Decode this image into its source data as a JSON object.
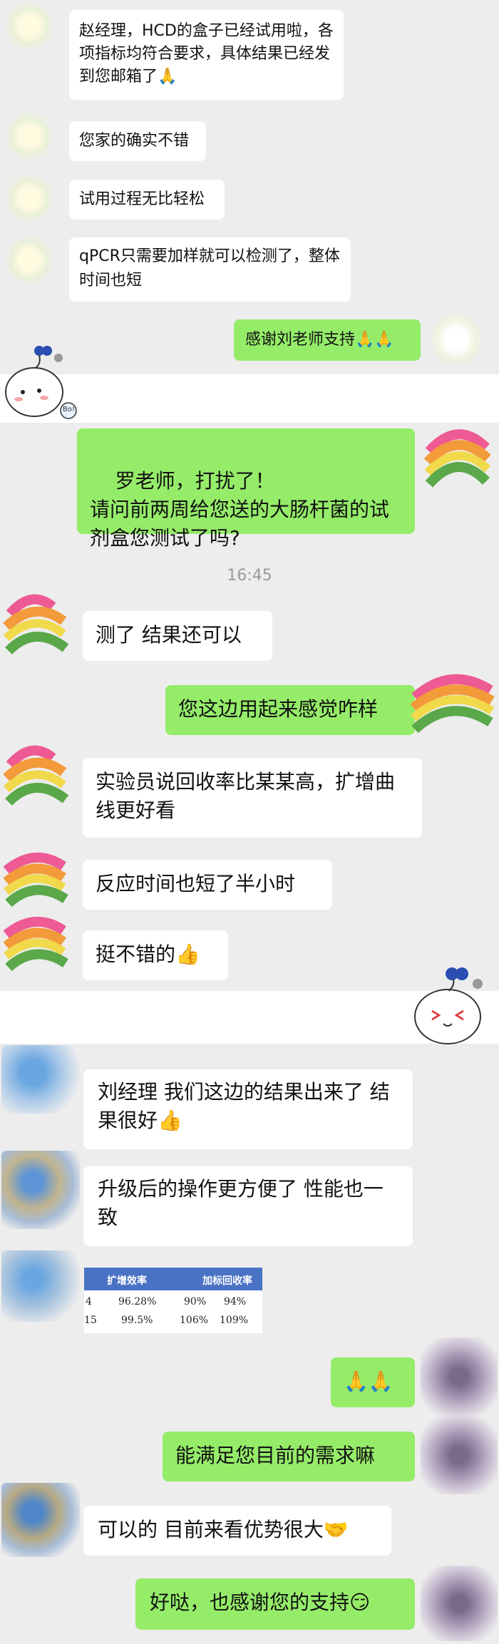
{
  "section1": {
    "messages": [
      {
        "side": "left",
        "text": "赵经理，HCD的盒子已经试用啦，各项指标均符合要求，具体结果已经发到您邮箱了🙏"
      },
      {
        "side": "left",
        "text": "您家的确实不错"
      },
      {
        "side": "left",
        "text": "试用过程无比轻松"
      },
      {
        "side": "left",
        "text": "qPCR只需要加样就可以检测了，整体时间也短"
      },
      {
        "side": "right",
        "text": "感谢刘老师支持🙏🙏"
      }
    ]
  },
  "sticker1_text": "Bo!",
  "section2": {
    "messages": [
      {
        "side": "right",
        "text": "罗老师，打扰了！\n请问前两周给您送的大肠杆菌的试剂盒您测试了吗?"
      }
    ],
    "timestamp": "16:45",
    "after": [
      {
        "side": "left",
        "text": "测了 结果还可以"
      },
      {
        "side": "right",
        "text": "您这边用起来感觉咋样"
      },
      {
        "side": "left",
        "text": "实验员说回收率比某某高，扩增曲线更好看"
      },
      {
        "side": "left",
        "text": "反应时间也短了半小时"
      },
      {
        "side": "left",
        "text": "挺不错的👍"
      }
    ]
  },
  "section3": {
    "messages": [
      {
        "side": "left",
        "text": "刘经理 我们这边的结果出来了 结果很好👍"
      },
      {
        "side": "left",
        "text": "升级后的操作更方便了 性能也一致"
      }
    ],
    "table": {
      "headers": [
        "扩增效率",
        "加标回收率"
      ],
      "rows": [
        {
          "id": "4",
          "eff": "96.28%",
          "r1": "90%",
          "r2": "94%"
        },
        {
          "id": "15",
          "eff": "99.5%",
          "r1": "106%",
          "r2": "109%"
        }
      ]
    },
    "after": [
      {
        "side": "right",
        "text": "🙏🙏"
      },
      {
        "side": "right",
        "text": "能满足您目前的需求嘛"
      },
      {
        "side": "left",
        "text": "可以的 目前来看优势很大🤝"
      },
      {
        "side": "right",
        "text": "好哒，也感谢您的支持😏"
      }
    ]
  },
  "colors": {
    "green": "#95ec69",
    "white": "#ffffff",
    "bg": "#ededed"
  }
}
